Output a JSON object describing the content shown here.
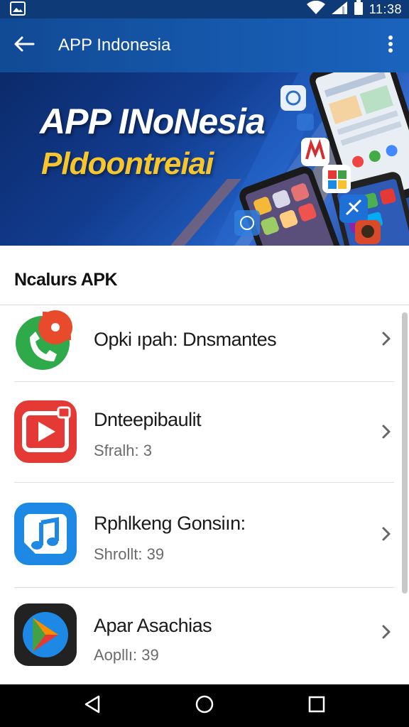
{
  "status_bar": {
    "time": "11:38",
    "icons": [
      "image-notification-icon",
      "wifi-icon",
      "signal-icon",
      "battery-icon"
    ]
  },
  "app_bar": {
    "title": "APP Indonesia",
    "back_icon": "arrow-left-icon",
    "more_icon": "more-vert-icon",
    "background": "#1659ad"
  },
  "banner": {
    "title": "APP INoNesia",
    "subtitle": "Pldoontreiai",
    "title_color": "#ffffff",
    "subtitle_color": "#f7c62c"
  },
  "section": {
    "title": "Ncalurs APK"
  },
  "apps": [
    {
      "title": "Opki ıpah: Dnsmantes",
      "subtitle": "",
      "icon": "phone-chat-icon",
      "icon_colors": [
        "#2eaa4a",
        "#e84b2c"
      ]
    },
    {
      "title": "Dnteepibaulit",
      "subtitle": "Sfralh: 3",
      "icon": "video-play-icon",
      "icon_colors": [
        "#e53935",
        "#ffffff"
      ]
    },
    {
      "title": "Rphlkeng Gonsiın:",
      "subtitle": "Shrollt: 39",
      "icon": "music-note-icon",
      "icon_colors": [
        "#1e88e5",
        "#ffffff"
      ]
    },
    {
      "title": "Apar Asachias",
      "subtitle": "Aopllı: 39",
      "icon": "play-store-icon",
      "icon_colors": [
        "#222222",
        "#43a047",
        "#fb8c00",
        "#e53935",
        "#1e88e5"
      ]
    }
  ],
  "nav_bar": {
    "buttons": [
      "back-triangle-icon",
      "home-circle-icon",
      "recents-square-icon"
    ]
  }
}
